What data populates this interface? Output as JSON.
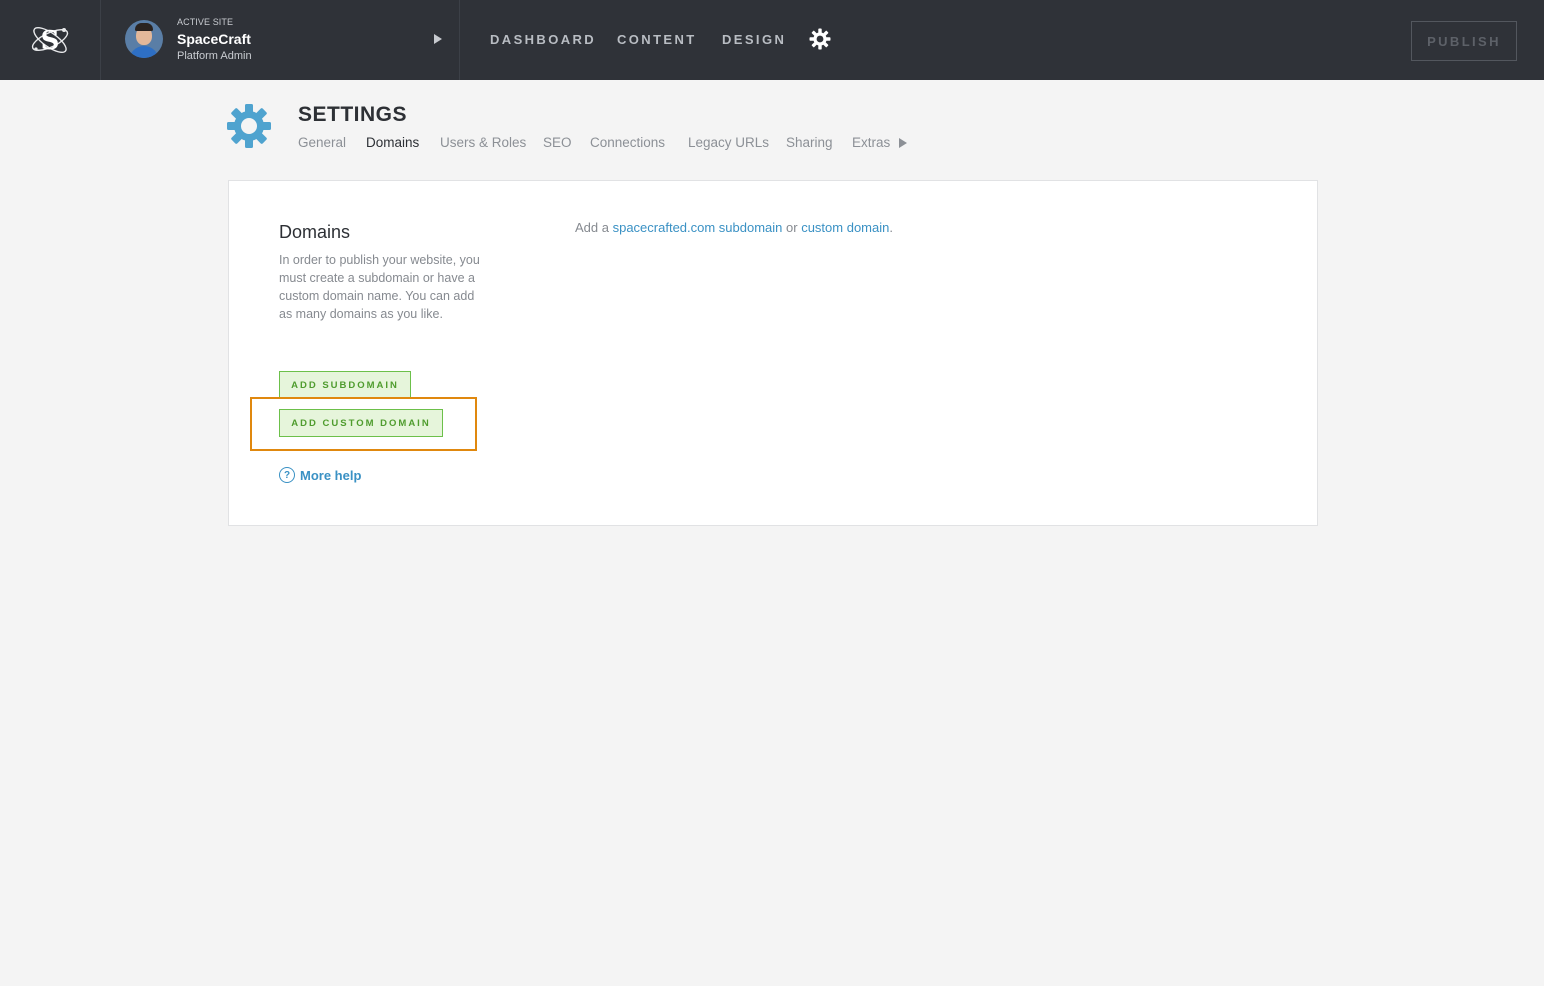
{
  "header": {
    "active_site_label": "ACTIVE SITE",
    "site_name": "SpaceCraft",
    "site_role": "Platform Admin",
    "nav": {
      "dashboard": "DASHBOARD",
      "content": "CONTENT",
      "design": "DESIGN"
    },
    "publish_label": "PUBLISH"
  },
  "settings": {
    "title": "SETTINGS",
    "tabs": [
      {
        "label": "General"
      },
      {
        "label": "Domains"
      },
      {
        "label": "Users & Roles"
      },
      {
        "label": "SEO"
      },
      {
        "label": "Connections"
      },
      {
        "label": "Legacy URLs"
      },
      {
        "label": "Sharing"
      },
      {
        "label": "Extras"
      }
    ],
    "active_tab": "Domains"
  },
  "domains": {
    "heading": "Domains",
    "description": "In order to publish your website, you must create a subdomain or have a custom domain name. You can add as many domains as you like.",
    "intro_prefix": "Add a ",
    "intro_link_subdomain": "spacecrafted.com subdomain",
    "intro_mid": " or ",
    "intro_link_custom": "custom domain",
    "intro_suffix": ".",
    "add_subdomain_label": "ADD SUBDOMAIN",
    "add_custom_domain_label": "ADD CUSTOM DOMAIN",
    "more_help_label": "More help",
    "help_icon_glyph": "?"
  },
  "colors": {
    "topbar": "#2f3238",
    "accent_blue": "#3a91c4",
    "settings_gear": "#4fa3cf",
    "button_green": "#6cc04a",
    "highlight_orange": "#e0880e"
  }
}
